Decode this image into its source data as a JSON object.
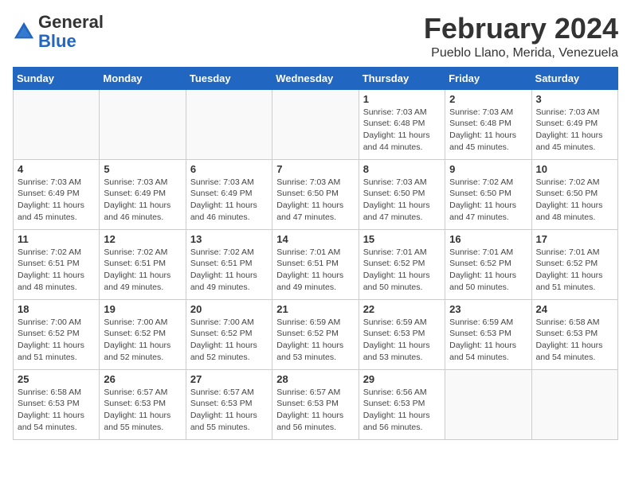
{
  "header": {
    "logo_general": "General",
    "logo_blue": "Blue",
    "month_title": "February 2024",
    "location": "Pueblo Llano, Merida, Venezuela"
  },
  "calendar": {
    "days_of_week": [
      "Sunday",
      "Monday",
      "Tuesday",
      "Wednesday",
      "Thursday",
      "Friday",
      "Saturday"
    ],
    "weeks": [
      [
        {
          "day": "",
          "info": ""
        },
        {
          "day": "",
          "info": ""
        },
        {
          "day": "",
          "info": ""
        },
        {
          "day": "",
          "info": ""
        },
        {
          "day": "1",
          "info": "Sunrise: 7:03 AM\nSunset: 6:48 PM\nDaylight: 11 hours\nand 44 minutes."
        },
        {
          "day": "2",
          "info": "Sunrise: 7:03 AM\nSunset: 6:48 PM\nDaylight: 11 hours\nand 45 minutes."
        },
        {
          "day": "3",
          "info": "Sunrise: 7:03 AM\nSunset: 6:49 PM\nDaylight: 11 hours\nand 45 minutes."
        }
      ],
      [
        {
          "day": "4",
          "info": "Sunrise: 7:03 AM\nSunset: 6:49 PM\nDaylight: 11 hours\nand 45 minutes."
        },
        {
          "day": "5",
          "info": "Sunrise: 7:03 AM\nSunset: 6:49 PM\nDaylight: 11 hours\nand 46 minutes."
        },
        {
          "day": "6",
          "info": "Sunrise: 7:03 AM\nSunset: 6:49 PM\nDaylight: 11 hours\nand 46 minutes."
        },
        {
          "day": "7",
          "info": "Sunrise: 7:03 AM\nSunset: 6:50 PM\nDaylight: 11 hours\nand 47 minutes."
        },
        {
          "day": "8",
          "info": "Sunrise: 7:03 AM\nSunset: 6:50 PM\nDaylight: 11 hours\nand 47 minutes."
        },
        {
          "day": "9",
          "info": "Sunrise: 7:02 AM\nSunset: 6:50 PM\nDaylight: 11 hours\nand 47 minutes."
        },
        {
          "day": "10",
          "info": "Sunrise: 7:02 AM\nSunset: 6:50 PM\nDaylight: 11 hours\nand 48 minutes."
        }
      ],
      [
        {
          "day": "11",
          "info": "Sunrise: 7:02 AM\nSunset: 6:51 PM\nDaylight: 11 hours\nand 48 minutes."
        },
        {
          "day": "12",
          "info": "Sunrise: 7:02 AM\nSunset: 6:51 PM\nDaylight: 11 hours\nand 49 minutes."
        },
        {
          "day": "13",
          "info": "Sunrise: 7:02 AM\nSunset: 6:51 PM\nDaylight: 11 hours\nand 49 minutes."
        },
        {
          "day": "14",
          "info": "Sunrise: 7:01 AM\nSunset: 6:51 PM\nDaylight: 11 hours\nand 49 minutes."
        },
        {
          "day": "15",
          "info": "Sunrise: 7:01 AM\nSunset: 6:52 PM\nDaylight: 11 hours\nand 50 minutes."
        },
        {
          "day": "16",
          "info": "Sunrise: 7:01 AM\nSunset: 6:52 PM\nDaylight: 11 hours\nand 50 minutes."
        },
        {
          "day": "17",
          "info": "Sunrise: 7:01 AM\nSunset: 6:52 PM\nDaylight: 11 hours\nand 51 minutes."
        }
      ],
      [
        {
          "day": "18",
          "info": "Sunrise: 7:00 AM\nSunset: 6:52 PM\nDaylight: 11 hours\nand 51 minutes."
        },
        {
          "day": "19",
          "info": "Sunrise: 7:00 AM\nSunset: 6:52 PM\nDaylight: 11 hours\nand 52 minutes."
        },
        {
          "day": "20",
          "info": "Sunrise: 7:00 AM\nSunset: 6:52 PM\nDaylight: 11 hours\nand 52 minutes."
        },
        {
          "day": "21",
          "info": "Sunrise: 6:59 AM\nSunset: 6:52 PM\nDaylight: 11 hours\nand 53 minutes."
        },
        {
          "day": "22",
          "info": "Sunrise: 6:59 AM\nSunset: 6:53 PM\nDaylight: 11 hours\nand 53 minutes."
        },
        {
          "day": "23",
          "info": "Sunrise: 6:59 AM\nSunset: 6:53 PM\nDaylight: 11 hours\nand 54 minutes."
        },
        {
          "day": "24",
          "info": "Sunrise: 6:58 AM\nSunset: 6:53 PM\nDaylight: 11 hours\nand 54 minutes."
        }
      ],
      [
        {
          "day": "25",
          "info": "Sunrise: 6:58 AM\nSunset: 6:53 PM\nDaylight: 11 hours\nand 54 minutes."
        },
        {
          "day": "26",
          "info": "Sunrise: 6:57 AM\nSunset: 6:53 PM\nDaylight: 11 hours\nand 55 minutes."
        },
        {
          "day": "27",
          "info": "Sunrise: 6:57 AM\nSunset: 6:53 PM\nDaylight: 11 hours\nand 55 minutes."
        },
        {
          "day": "28",
          "info": "Sunrise: 6:57 AM\nSunset: 6:53 PM\nDaylight: 11 hours\nand 56 minutes."
        },
        {
          "day": "29",
          "info": "Sunrise: 6:56 AM\nSunset: 6:53 PM\nDaylight: 11 hours\nand 56 minutes."
        },
        {
          "day": "",
          "info": ""
        },
        {
          "day": "",
          "info": ""
        }
      ]
    ]
  }
}
